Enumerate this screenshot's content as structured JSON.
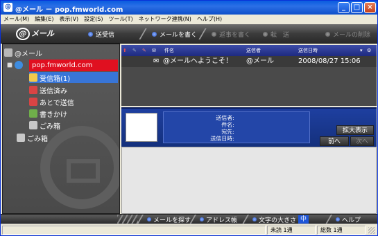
{
  "window": {
    "title": "@メール － pop.fmworld.com",
    "minimize": "_",
    "maximize": "□",
    "close": "×"
  },
  "menu": [
    "メール(M)",
    "編集(E)",
    "表示(V)",
    "設定(S)",
    "ツール(T)",
    "ネットワーク連携(N)",
    "ヘルプ(H)"
  ],
  "toolbar": {
    "logo": "メール",
    "send_receive": "送受信",
    "compose": "メールを書く",
    "reply": "返事を書く",
    "forward": "転　送",
    "delete": "メールの削除"
  },
  "folders": {
    "root": "@メール",
    "account": "pop.fmworld.com",
    "inbox": "受信箱(1)",
    "sent": "送信済み",
    "outbox": "あとで送信",
    "drafts": "書きかけ",
    "trash_account": "ごみ箱",
    "trash_root": "ごみ箱"
  },
  "mail_list": {
    "col_subject": "件名",
    "col_sender": "送信者",
    "col_date": "送信日時",
    "rows": [
      {
        "subject": "@メールへようこそ！",
        "sender": "@メール",
        "date": "2008/08/27 15:06"
      }
    ]
  },
  "preview": {
    "label_sender": "送信者:",
    "label_subject": "件名:",
    "label_to": "宛先:",
    "label_date": "送信日時:",
    "zoom": "拡大表示",
    "prev": "前へ",
    "next": "次へ"
  },
  "bottom_toolbar": {
    "find": "メールを探す",
    "address": "アドレス帳",
    "font_size": "文字の大きさ",
    "font_size_value": "中",
    "help": "ヘルプ"
  },
  "status": {
    "unread": "未読 1通",
    "total": "総数 1通"
  },
  "colors": {
    "accent_blue": "#3875D7",
    "selection_red": "#E01020",
    "toolbar_dark": "#3C3C3C"
  }
}
